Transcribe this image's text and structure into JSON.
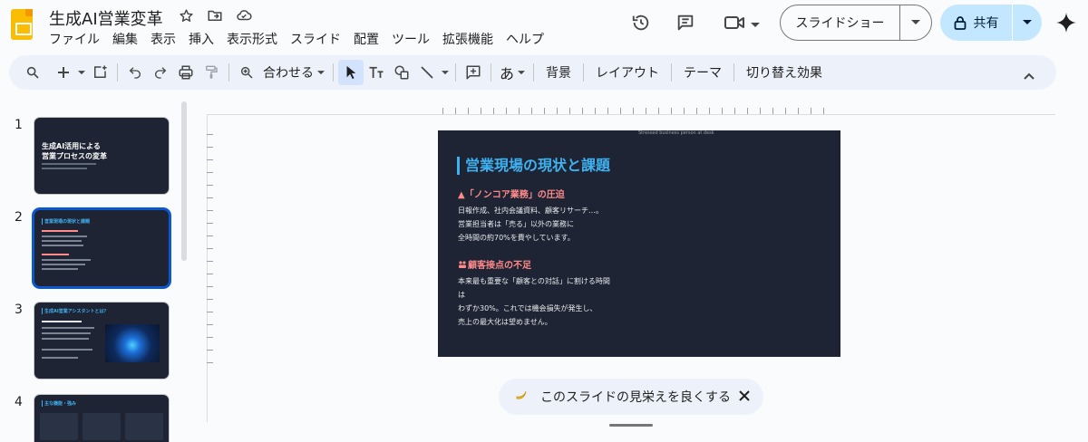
{
  "header": {
    "doc_title": "生成AI営業変革",
    "menu": [
      "ファイル",
      "編集",
      "表示",
      "挿入",
      "表示形式",
      "スライド",
      "配置",
      "ツール",
      "拡張機能",
      "ヘルプ"
    ],
    "slideshow_label": "スライドショー",
    "share_label": "共有"
  },
  "toolbar": {
    "zoom_label": "合わせる",
    "background_label": "背景",
    "layout_label": "レイアウト",
    "theme_label": "テーマ",
    "transition_label": "切り替え効果"
  },
  "filmstrip": {
    "slides": [
      {
        "number": "1",
        "title": "生成AI活用による\n営業プロセスの変革"
      },
      {
        "number": "2",
        "title": "営業現場の現状と課題"
      },
      {
        "number": "3",
        "title": "生成AI営業アシスタントとは？"
      },
      {
        "number": "4",
        "title": "主な機能・強み"
      }
    ]
  },
  "slide": {
    "image_alt": "Stressed business person at desk",
    "title": "営業現場の現状と課題",
    "section1_heading": "▲「ノンコア業務」の圧迫",
    "section1_lines": [
      "日報作成、社内会議資料、顧客リサーチ…。",
      "営業担当者は「売る」以外の業務に",
      "全時間の約70%を費やしています。"
    ],
    "section2_heading": "顧客接点の不足",
    "section2_lines": [
      "本来最も重要な「顧客との対話」に割ける時間",
      "は",
      "わずか30%。これでは機会損失が発生し、",
      "売上の最大化は望めません。"
    ]
  },
  "suggestion": {
    "text": "このスライドの見栄えを良くする"
  },
  "colors": {
    "accent": "#0b57d0",
    "share_bg": "#c2e7ff",
    "slide_bg": "#1e2433",
    "slide_title": "#3fb1f0",
    "slide_heading": "#ff8a8a"
  }
}
